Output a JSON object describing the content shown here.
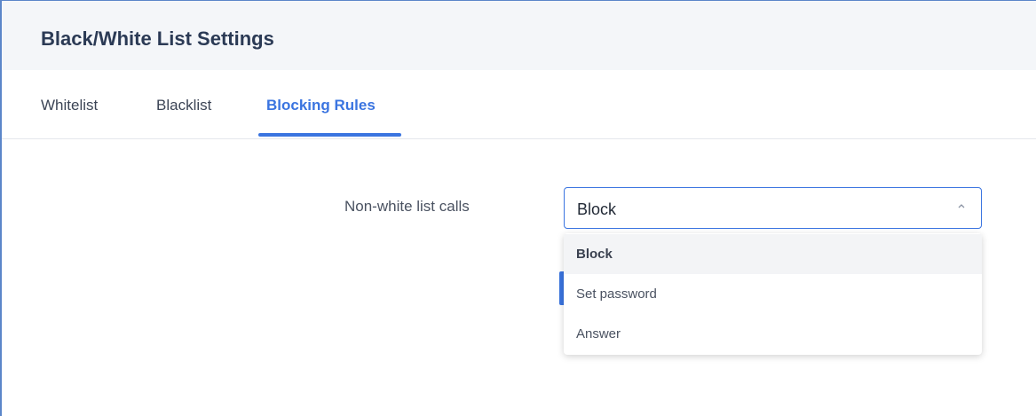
{
  "header": {
    "title": "Black/White List Settings"
  },
  "tabs": [
    {
      "label": "Whitelist",
      "active": false
    },
    {
      "label": "Blacklist",
      "active": false
    },
    {
      "label": "Blocking Rules",
      "active": true
    }
  ],
  "form": {
    "non_white_list_calls": {
      "label": "Non-white list calls",
      "value": "Block",
      "options": [
        "Block",
        "Set password",
        "Answer"
      ],
      "selected_index": 0,
      "expanded": true
    }
  },
  "icons": {
    "select_chevron": "chevron-up-icon"
  },
  "colors": {
    "accent": "#3a74e0",
    "header_bg": "#f4f6f9",
    "title_text": "#2b3a55",
    "option_highlight": "#f3f4f6"
  }
}
